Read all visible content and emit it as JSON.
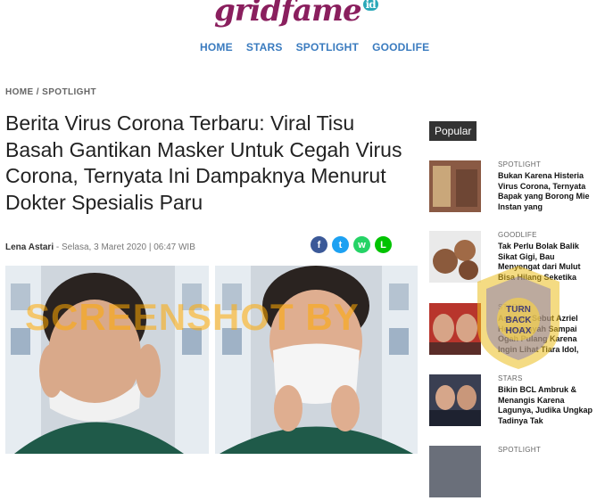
{
  "header": {
    "logo_text": "gridfame",
    "logo_suffix": "id"
  },
  "nav": {
    "items": [
      {
        "label": "HOME"
      },
      {
        "label": "STARS"
      },
      {
        "label": "SPOTLIGHT"
      },
      {
        "label": "GOODLIFE"
      }
    ]
  },
  "breadcrumb": "HOME / SPOTLIGHT",
  "article": {
    "headline": "Berita Virus Corona Terbaru: Viral Tisu Basah Gantikan Masker Untuk Cegah Virus Corona, Ternyata Ini Dampaknya Menurut Dokter Spesialis Paru",
    "author": "Lena Astari",
    "date": " - Selasa, 3 Maret 2020 | 06:47 WIB",
    "share": [
      {
        "icon": "facebook-icon",
        "color": "#3b5998",
        "glyph": "f"
      },
      {
        "icon": "twitter-icon",
        "color": "#1da1f2",
        "glyph": "t"
      },
      {
        "icon": "whatsapp-icon",
        "color": "#25d366",
        "glyph": "w"
      },
      {
        "icon": "line-icon",
        "color": "#00c300",
        "glyph": "L"
      }
    ]
  },
  "watermark": "SCREENSHOT BY",
  "sidebar": {
    "title": "Popular",
    "items": [
      {
        "category": "SPOTLIGHT",
        "title": "Bukan Karena Histeria Virus Corona, Ternyata Bapak yang Borong Mie Instan yang"
      },
      {
        "category": "GOODLIFE",
        "title": "Tak Perlu Bolak Balik Sikat Gigi, Bau Menyengat dari Mulut Bisa Hilang Seketika"
      },
      {
        "category": "STARS",
        "title": "Ashanty Sebut Azriel Hermansyah Sampai Ogah Pulang Karena Ingin Lihat Tiara Idol,"
      },
      {
        "category": "STARS",
        "title": "Bikin BCL Ambruk & Menangis Karena Lagunya, Judika Ungkap Tadinya Tak"
      },
      {
        "category": "SPOTLIGHT",
        "title": ""
      }
    ]
  },
  "seal_text": "TURN BACK HOAX"
}
